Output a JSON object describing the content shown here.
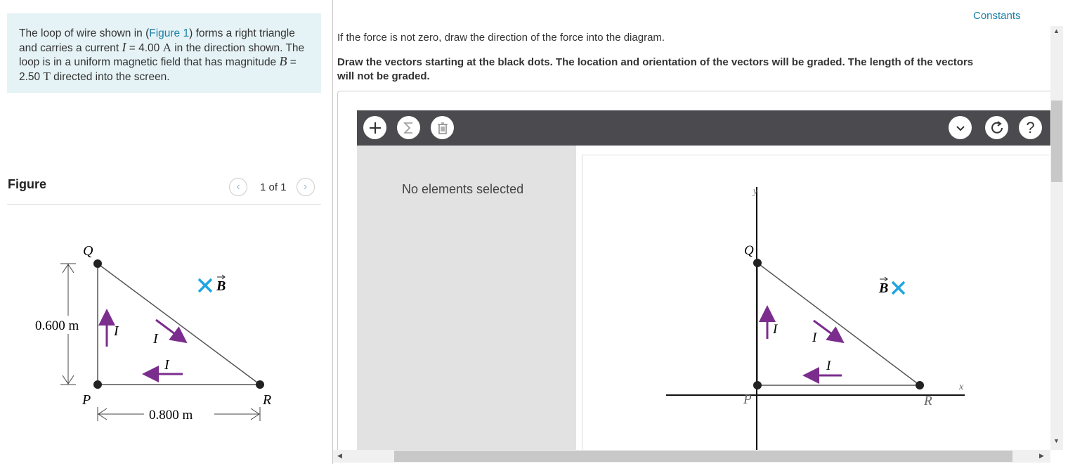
{
  "problem": {
    "p1": "The loop of wire shown in (",
    "figure_link": "Figure 1",
    "p2": ") forms a right triangle and carries a current ",
    "current_symbol": "I",
    "p3": " = 4.00 ",
    "current_unit": "A",
    "p4": " in the direction shown. The loop is in a uniform magnetic field that has magnitude ",
    "field_symbol": "B",
    "p5": " = 2.50 ",
    "field_unit": "T",
    "p6": " directed into the screen."
  },
  "figure": {
    "title": "Figure",
    "pager_text": "1 of 1",
    "height_label": "0.600 m",
    "width_label": "0.800 m",
    "labels": {
      "Q": "Q",
      "P": "P",
      "R": "R",
      "I": "I",
      "B": "B"
    }
  },
  "constants_link": "Constants",
  "instructions": {
    "line1": "If the force is not zero, draw the direction of the force into the diagram.",
    "line2": "Draw the vectors starting at the black dots. The location and orientation of the vectors will be graded. The length of the vectors will not be graded."
  },
  "tool": {
    "no_selection": "No elements selected",
    "axes": {
      "y": "y",
      "x": "x"
    }
  },
  "colors": {
    "purple": "#7b2d8e",
    "cyan": "#1ea5e0",
    "link": "#1a7fa6",
    "toolbar": "#4a4a4f"
  }
}
